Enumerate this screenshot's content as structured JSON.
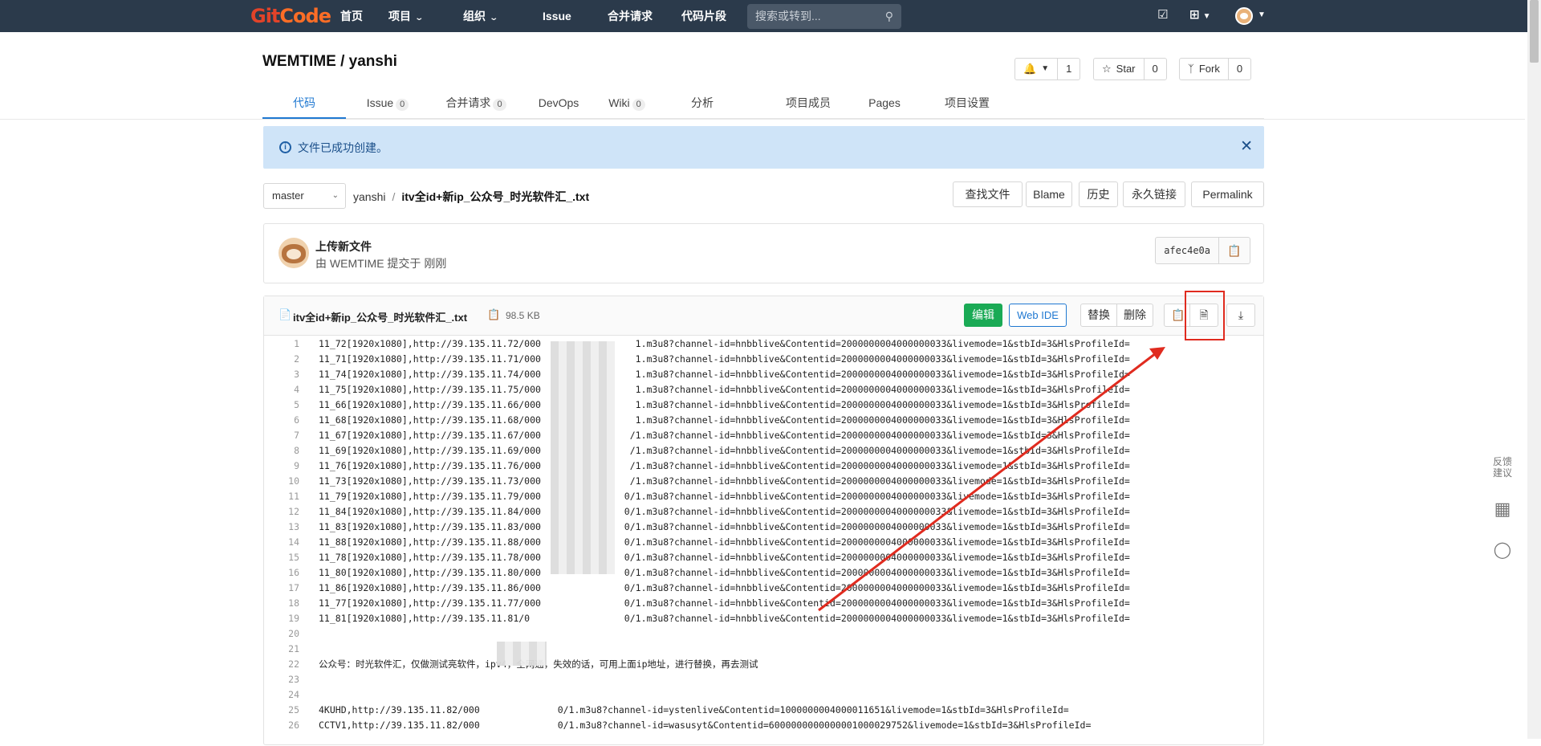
{
  "nav": {
    "logo_git": "Git",
    "logo_code": "Code",
    "items": [
      "首页",
      "项目",
      "组织",
      "Issue",
      "合并请求",
      "代码片段"
    ],
    "search_placeholder": "搜索或转到..."
  },
  "repo": {
    "title": "WEMTIME / yanshi",
    "watch_count": "1",
    "star_label": "Star",
    "star_count": "0",
    "fork_label": "Fork",
    "fork_count": "0"
  },
  "tabs": [
    {
      "label": "代码",
      "badge": ""
    },
    {
      "label": "Issue",
      "badge": "0"
    },
    {
      "label": "合并请求",
      "badge": "0"
    },
    {
      "label": "DevOps",
      "badge": ""
    },
    {
      "label": "Wiki",
      "badge": "0"
    },
    {
      "label": "分析",
      "badge": ""
    },
    {
      "label": "项目成员",
      "badge": ""
    },
    {
      "label": "Pages",
      "badge": ""
    },
    {
      "label": "项目设置",
      "badge": ""
    }
  ],
  "alert": {
    "message": "文件已成功创建。"
  },
  "pathbar": {
    "branch": "master",
    "root": "yanshi",
    "file": "itv全id+新ip_公众号_时光软件汇_.txt",
    "buttons": [
      "查找文件",
      "Blame",
      "历史",
      "永久链接",
      "Permalink"
    ]
  },
  "commit": {
    "title": "上传新文件",
    "subtitle": "由 WEMTIME 提交于 刚刚",
    "sha": "afec4e0a"
  },
  "file": {
    "name": "itv全id+新ip_公众号_时光软件汇_.txt",
    "size": "98.5 KB",
    "edit": "编辑",
    "webide": "Web IDE",
    "replace": "替换",
    "delete": "删除"
  },
  "code_lines": [
    "11_72[1920x1080],http://39.135.11.72/000                 1.m3u8?channel-id=hnbblive&Contentid=2000000004000000033&livemode=1&stbId=3&HlsProfileId=",
    "11_71[1920x1080],http://39.135.11.71/000                 1.m3u8?channel-id=hnbblive&Contentid=2000000004000000033&livemode=1&stbId=3&HlsProfileId=",
    "11_74[1920x1080],http://39.135.11.74/000                 1.m3u8?channel-id=hnbblive&Contentid=2000000004000000033&livemode=1&stbId=3&HlsProfileId=",
    "11_75[1920x1080],http://39.135.11.75/000                 1.m3u8?channel-id=hnbblive&Contentid=2000000004000000033&livemode=1&stbId=3&HlsProfileId=",
    "11_66[1920x1080],http://39.135.11.66/000                 1.m3u8?channel-id=hnbblive&Contentid=2000000004000000033&livemode=1&stbId=3&HlsProfileId=",
    "11_68[1920x1080],http://39.135.11.68/000                 1.m3u8?channel-id=hnbblive&Contentid=2000000004000000033&livemode=1&stbId=3&HlsProfileId=",
    "11_67[1920x1080],http://39.135.11.67/000                /1.m3u8?channel-id=hnbblive&Contentid=2000000004000000033&livemode=1&stbId=3&HlsProfileId=",
    "11_69[1920x1080],http://39.135.11.69/000                /1.m3u8?channel-id=hnbblive&Contentid=2000000004000000033&livemode=1&stbId=3&HlsProfileId=",
    "11_76[1920x1080],http://39.135.11.76/000                /1.m3u8?channel-id=hnbblive&Contentid=2000000004000000033&livemode=1&stbId=3&HlsProfileId=",
    "11_73[1920x1080],http://39.135.11.73/000                /1.m3u8?channel-id=hnbblive&Contentid=2000000004000000033&livemode=1&stbId=3&HlsProfileId=",
    "11_79[1920x1080],http://39.135.11.79/000               0/1.m3u8?channel-id=hnbblive&Contentid=2000000004000000033&livemode=1&stbId=3&HlsProfileId=",
    "11_84[1920x1080],http://39.135.11.84/000               0/1.m3u8?channel-id=hnbblive&Contentid=2000000004000000033&livemode=1&stbId=3&HlsProfileId=",
    "11_83[1920x1080],http://39.135.11.83/000               0/1.m3u8?channel-id=hnbblive&Contentid=2000000004000000033&livemode=1&stbId=3&HlsProfileId=",
    "11_88[1920x1080],http://39.135.11.88/000               0/1.m3u8?channel-id=hnbblive&Contentid=2000000004000000033&livemode=1&stbId=3&HlsProfileId=",
    "11_78[1920x1080],http://39.135.11.78/000               0/1.m3u8?channel-id=hnbblive&Contentid=2000000004000000033&livemode=1&stbId=3&HlsProfileId=",
    "11_80[1920x1080],http://39.135.11.80/000               0/1.m3u8?channel-id=hnbblive&Contentid=2000000004000000033&livemode=1&stbId=3&HlsProfileId=",
    "11_86[1920x1080],http://39.135.11.86/000               0/1.m3u8?channel-id=hnbblive&Contentid=2000000004000000033&livemode=1&stbId=3&HlsProfileId=",
    "11_77[1920x1080],http://39.135.11.77/000               0/1.m3u8?channel-id=hnbblive&Contentid=2000000004000000033&livemode=1&stbId=3&HlsProfileId=",
    "11_81[1920x1080],http://39.135.11.81/0                 0/1.m3u8?channel-id=hnbblive&Contentid=2000000004000000033&livemode=1&stbId=3&HlsProfileId=",
    "",
    "",
    "公众号：时光软件汇，仅做测试亮软件，ipv4，全网通，失效的话，可用上面ip地址，进行替换，再去测试",
    "",
    "",
    "4KUHD,http://39.135.11.82/000              0/1.m3u8?channel-id=ystenlive&Contentid=1000000004000011651&livemode=1&stbId=3&HlsProfileId=",
    "CCTV1,http://39.135.11.82/000              0/1.m3u8?channel-id=wasusyt&Contentid=6000000000000001000029752&livemode=1&stbId=3&HlsProfileId="
  ],
  "side": {
    "feedback": "反馈建议"
  },
  "colors": {
    "nav_bg": "#2b3a4b",
    "accent": "#1f78d1",
    "success": "#1aaa55",
    "alert_bg": "#cfe4f8",
    "highlight": "#e02b1f"
  }
}
